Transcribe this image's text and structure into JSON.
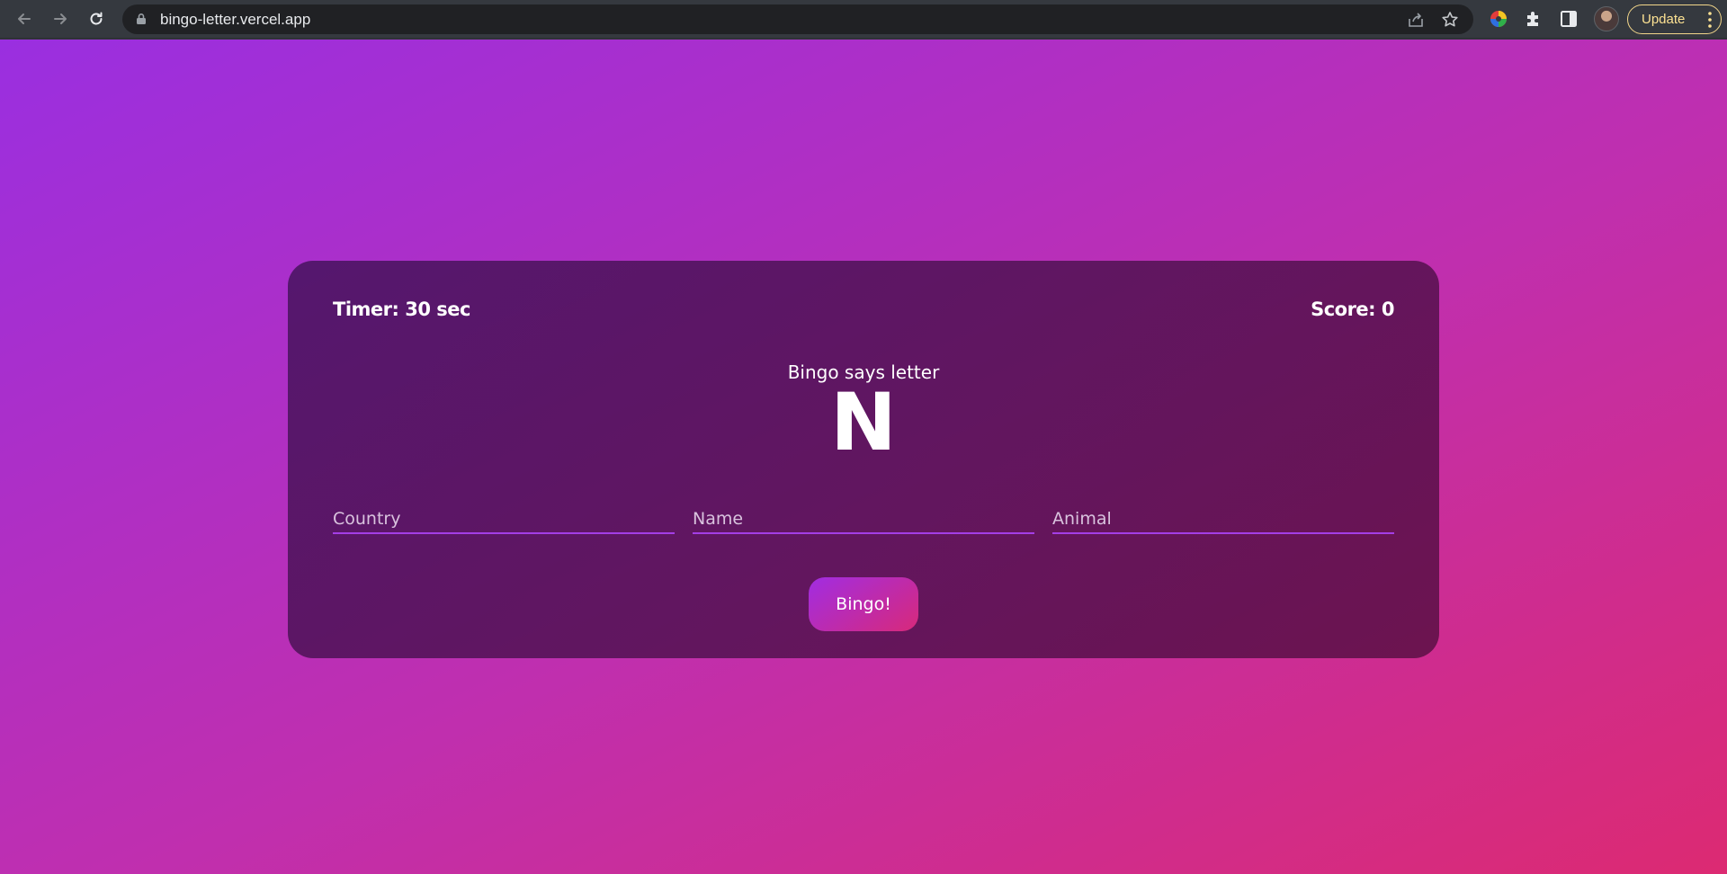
{
  "browser": {
    "url": "bingo-letter.vercel.app",
    "update_label": "Update"
  },
  "game": {
    "timer_text": "Timer: 30 sec",
    "score_text": "Score: 0",
    "says_text": "Bingo says letter",
    "letter": "N",
    "fields": {
      "country_placeholder": "Country",
      "name_placeholder": "Name",
      "animal_placeholder": "Animal"
    },
    "button_label": "Bingo!"
  },
  "colors": {
    "gradient_start": "#9a2fe0",
    "gradient_end": "#dc2a72",
    "input_underline": "#a43ee6"
  }
}
